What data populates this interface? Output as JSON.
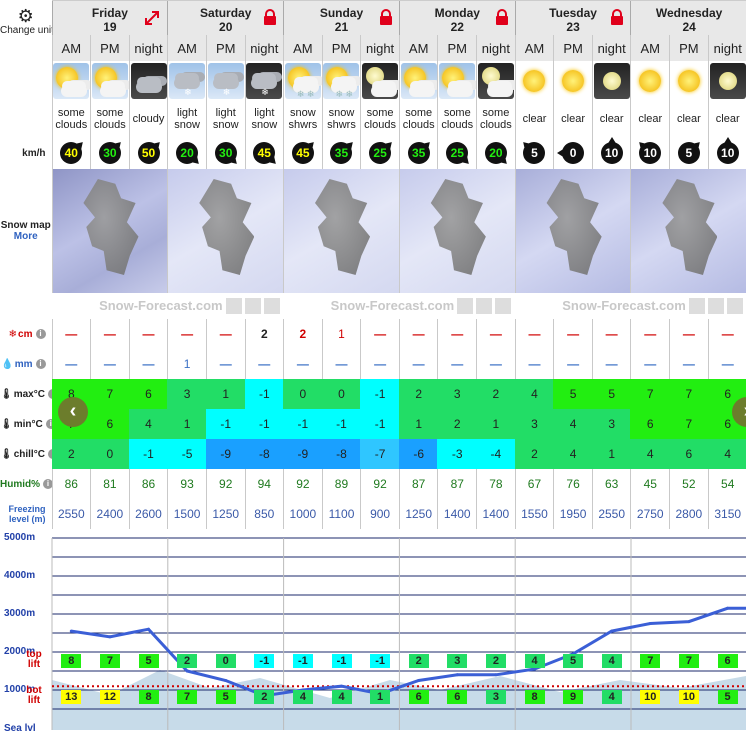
{
  "labels": {
    "change_units": "Change units",
    "kmh": "km/h",
    "snow_map": "Snow map",
    "more": "More",
    "snow_cm": "cm",
    "rain_mm": "mm",
    "max": "max°C",
    "min": "min°C",
    "chill": "chill°C",
    "humid": "Humid%",
    "freezing": "Freezing level (m)",
    "brand": "Snow-Forecast.com",
    "top_lift": "top lift",
    "bot_lift": "bot lift",
    "sea_lvl": "Sea lvl"
  },
  "days": [
    {
      "name": "Friday",
      "date": "19",
      "badge": "expand"
    },
    {
      "name": "Saturday",
      "date": "20",
      "badge": "lock"
    },
    {
      "name": "Sunday",
      "date": "21",
      "badge": "lock"
    },
    {
      "name": "Monday",
      "date": "22",
      "badge": "lock"
    },
    {
      "name": "Tuesday",
      "date": "23",
      "badge": "lock"
    },
    {
      "name": "Wednesday",
      "date": "24",
      "badge": "none"
    }
  ],
  "tod": [
    "AM",
    "PM",
    "night",
    "AM",
    "PM",
    "night",
    "AM",
    "PM",
    "night",
    "AM",
    "PM",
    "night",
    "AM",
    "PM",
    "night",
    "AM",
    "PM",
    "night"
  ],
  "weather": [
    {
      "icon": "sun-cloud-icon",
      "desc": "some clouds"
    },
    {
      "icon": "sun-cloud-icon",
      "desc": "some clouds"
    },
    {
      "icon": "night-cloud-icon",
      "desc": "cloudy"
    },
    {
      "icon": "snow-cloud-icon",
      "desc": "light snow"
    },
    {
      "icon": "snow-cloud-icon",
      "desc": "light snow"
    },
    {
      "icon": "night-snow-icon",
      "desc": "light snow"
    },
    {
      "icon": "sun-snow-icon",
      "desc": "snow shwrs"
    },
    {
      "icon": "sun-snow-icon",
      "desc": "snow shwrs"
    },
    {
      "icon": "night-moon-cloud-icon",
      "desc": "some clouds"
    },
    {
      "icon": "sun-cloud-icon",
      "desc": "some clouds"
    },
    {
      "icon": "sun-cloud-icon",
      "desc": "some clouds"
    },
    {
      "icon": "night-moon-cloud-icon",
      "desc": "some clouds"
    },
    {
      "icon": "sun-icon",
      "desc": "clear"
    },
    {
      "icon": "sun-icon",
      "desc": "clear"
    },
    {
      "icon": "moon-icon",
      "desc": "clear"
    },
    {
      "icon": "sun-icon",
      "desc": "clear"
    },
    {
      "icon": "sun-icon",
      "desc": "clear"
    },
    {
      "icon": "moon-icon",
      "desc": "clear"
    }
  ],
  "wind": [
    {
      "v": "40",
      "dir": "ne",
      "color": "#ffff00"
    },
    {
      "v": "30",
      "dir": "ne",
      "color": "#22ee11"
    },
    {
      "v": "50",
      "dir": "ne",
      "color": "#ffff00"
    },
    {
      "v": "20",
      "dir": "se",
      "color": "#22ee11"
    },
    {
      "v": "30",
      "dir": "se",
      "color": "#22ee11"
    },
    {
      "v": "45",
      "dir": "se",
      "color": "#ffff00"
    },
    {
      "v": "45",
      "dir": "ne",
      "color": "#ffff00"
    },
    {
      "v": "35",
      "dir": "ne",
      "color": "#22ee11"
    },
    {
      "v": "25",
      "dir": "ne",
      "color": "#22ee11"
    },
    {
      "v": "35",
      "dir": "ne",
      "color": "#22ee11"
    },
    {
      "v": "25",
      "dir": "se",
      "color": "#22ee11"
    },
    {
      "v": "20",
      "dir": "se",
      "color": "#22ee11"
    },
    {
      "v": "5",
      "dir": "nw",
      "color": "#ffffff"
    },
    {
      "v": "0",
      "dir": "w",
      "color": "#ffffff"
    },
    {
      "v": "10",
      "dir": "n",
      "color": "#ffffff"
    },
    {
      "v": "10",
      "dir": "nw",
      "color": "#ffffff"
    },
    {
      "v": "5",
      "dir": "ne",
      "color": "#ffffff"
    },
    {
      "v": "10",
      "dir": "n",
      "color": "#ffffff"
    }
  ],
  "snow": [
    "—",
    "—",
    "—",
    "—",
    "—",
    "2",
    "2",
    "1",
    "—",
    "—",
    "—",
    "—",
    "—",
    "—",
    "—",
    "—",
    "—",
    "—"
  ],
  "rain": [
    "—",
    "—",
    "—",
    "1",
    "—",
    "—",
    "—",
    "—",
    "—",
    "—",
    "—",
    "—",
    "—",
    "—",
    "—",
    "—",
    "—",
    "—"
  ],
  "max": [
    "8",
    "7",
    "6",
    "3",
    "1",
    "-1",
    "0",
    "0",
    "-1",
    "2",
    "3",
    "2",
    "4",
    "5",
    "5",
    "7",
    "7",
    "6"
  ],
  "min": [
    "7",
    "6",
    "4",
    "1",
    "-1",
    "-1",
    "-1",
    "-1",
    "-1",
    "1",
    "2",
    "1",
    "3",
    "4",
    "3",
    "6",
    "7",
    "6"
  ],
  "chill": [
    "2",
    "0",
    "-1",
    "-5",
    "-9",
    "-8",
    "-9",
    "-8",
    "-7",
    "-6",
    "-3",
    "-4",
    "2",
    "4",
    "1",
    "4",
    "6",
    "4"
  ],
  "humid": [
    "86",
    "81",
    "86",
    "93",
    "92",
    "94",
    "92",
    "89",
    "92",
    "87",
    "87",
    "78",
    "67",
    "76",
    "63",
    "45",
    "52",
    "54"
  ],
  "freeze": [
    "2550",
    "2400",
    "2600",
    "1500",
    "1250",
    "850",
    "1000",
    "1100",
    "900",
    "1250",
    "1400",
    "1400",
    "1550",
    "1950",
    "2550",
    "2750",
    "2800",
    "3150"
  ],
  "top_lift": [
    "8",
    "7",
    "5",
    "2",
    "0",
    "-1",
    "-1",
    "-1",
    "-1",
    "2",
    "3",
    "2",
    "4",
    "5",
    "4",
    "7",
    "7",
    "6"
  ],
  "bot_lift": [
    "13",
    "12",
    "8",
    "7",
    "5",
    "2",
    "4",
    "4",
    "1",
    "6",
    "6",
    "3",
    "8",
    "9",
    "4",
    "10",
    "10",
    "5"
  ],
  "colors": {
    "max": [
      "#22ee11",
      "#22ee11",
      "#22ee11",
      "#22dd66",
      "#22dd66",
      "#00ffff",
      "#22dd66",
      "#22dd66",
      "#00ffff",
      "#22dd66",
      "#22dd66",
      "#22dd66",
      "#22dd66",
      "#22ee11",
      "#22ee11",
      "#22ee11",
      "#22ee11",
      "#22ee11"
    ],
    "min": [
      "#22ee11",
      "#22ee11",
      "#22dd66",
      "#22dd66",
      "#00ffff",
      "#00ffff",
      "#00ffff",
      "#00ffff",
      "#00ffff",
      "#22dd66",
      "#22dd66",
      "#22dd66",
      "#22dd66",
      "#22dd66",
      "#22dd66",
      "#22ee11",
      "#22ee11",
      "#22ee11"
    ],
    "chill": [
      "#22dd66",
      "#22dd66",
      "#00ffff",
      "#00ffff",
      "#1aa0ff",
      "#1aa0ff",
      "#1aa0ff",
      "#1aa0ff",
      "#2fc6ff",
      "#1aa0ff",
      "#00ffff",
      "#00ffff",
      "#22dd66",
      "#22dd66",
      "#22dd66",
      "#22dd66",
      "#22dd66",
      "#22dd66"
    ],
    "top_lift": [
      "#22ee11",
      "#22ee11",
      "#22ee11",
      "#22dd66",
      "#22dd66",
      "#00ffff",
      "#00ffff",
      "#00ffff",
      "#00ffff",
      "#22dd66",
      "#22dd66",
      "#22dd66",
      "#22dd66",
      "#22dd66",
      "#22dd66",
      "#22ee11",
      "#22ee11",
      "#22ee11"
    ],
    "bot_lift": [
      "#ffff00",
      "#ffff00",
      "#22ee11",
      "#22ee11",
      "#22ee11",
      "#22dd66",
      "#22dd66",
      "#22dd66",
      "#22dd66",
      "#22ee11",
      "#22ee11",
      "#22dd66",
      "#22ee11",
      "#22ee11",
      "#22dd66",
      "#ffff00",
      "#ffff00",
      "#22ee11"
    ]
  },
  "chart_data": {
    "type": "line",
    "ylabels": [
      "5000m",
      "4000m",
      "3000m",
      "2000m",
      "1000m"
    ],
    "ylim": [
      0,
      5000
    ],
    "series": [
      {
        "values": [
          2550,
          2400,
          2600,
          1500,
          1250,
          850,
          1000,
          1100,
          900,
          1250,
          1400,
          1400,
          1550,
          1950,
          2550,
          2750,
          2800,
          3150
        ]
      }
    ]
  }
}
